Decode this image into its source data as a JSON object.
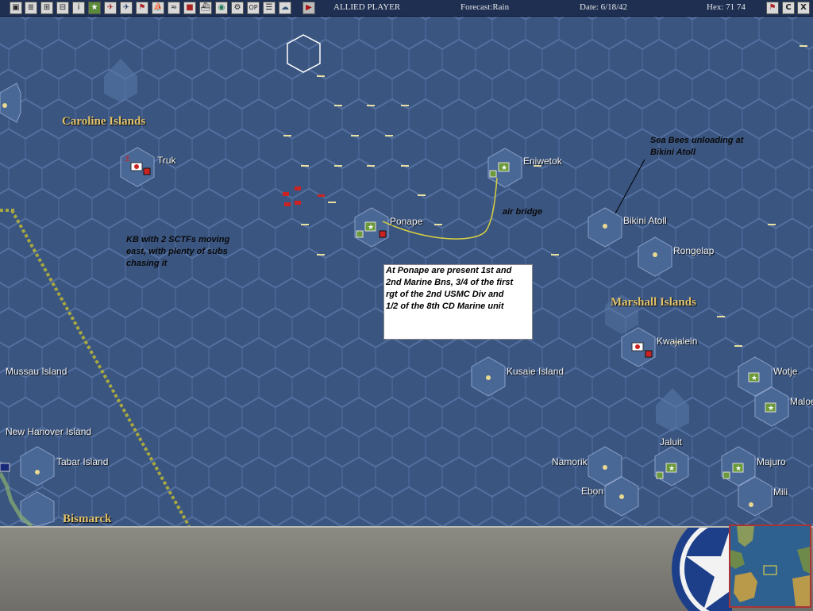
{
  "toolbar": {
    "icons": [
      "menu-icon",
      "report-icon",
      "air-icon",
      "ship-icon",
      "info-icon",
      "ground-icon",
      "plane-icon",
      "fighter-icon",
      "flag-icon",
      "landing-icon",
      "sub-icon",
      "supply-icon",
      "convoy-icon",
      "globe-icon",
      "settings-icon",
      "op-icon",
      "list-icon",
      "cloud-icon"
    ],
    "op_text": "OP",
    "player": "ALLIED PLAYER",
    "forecast": "Forecast:Rain",
    "date": "Date: 6/18/42",
    "hex": "Hex: 71  74",
    "right_icons": [
      "flag-icon",
      "c-icon",
      "close-icon"
    ],
    "c_text": "C",
    "x_text": "X"
  },
  "map": {
    "regions": {
      "caroline": "Caroline Islands",
      "marshall": "Marshall Islands",
      "bismarck": "Bismarck"
    },
    "bases": {
      "truk": "Truk",
      "eniwetok": "Eniwetok",
      "ponape": "Ponape",
      "bikini": "Bikini Atoll",
      "rongelap": "Rongelap",
      "kwajalein": "Kwajalein",
      "kusaie": "Kusaie Island",
      "wotje": "Wotje",
      "maloelap": "Maloe",
      "jaluit": "Jaluit",
      "majuro": "Majuro",
      "mili": "Mili",
      "namorik": "Namorik",
      "ebon": "Ebon",
      "mussau": "Mussau Island",
      "new_hanover": "New Hanover Island",
      "tabar": "Tabar Island"
    },
    "notes": {
      "kb": [
        "KB with 2 SCTFs moving",
        "east, with plenty of subs",
        "chasing it"
      ],
      "seabees": [
        "Sea Bees unloading at",
        "Bikini Atoll"
      ],
      "air_bridge": "air bridge",
      "ponape_info": [
        "At Ponape are present 1st and",
        "2nd Marine Bns, 3/4 of the first",
        "rgt of the 2nd USMC Div and",
        "1/2 of the 8th CD Marine unit"
      ]
    },
    "colors": {
      "ocean": "#3a5580",
      "hex_line": "#5470a0",
      "region_label": "#e2c36a",
      "japanese": "#cc2222",
      "allied": "#e8e8e8",
      "route": "#d8d040"
    }
  },
  "bottom_panel": {
    "emblem": "allied-star-emblem-icon",
    "minimap": "theater-minimap"
  }
}
